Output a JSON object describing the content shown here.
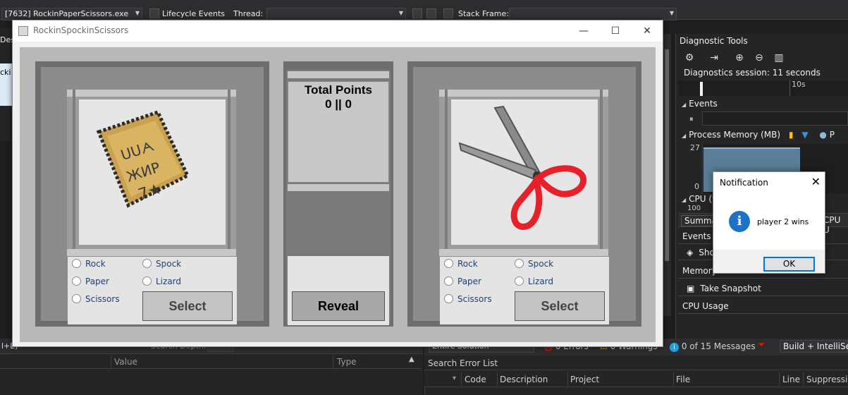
{
  "vs": {
    "process_combo": "[7632] RockinPaperScissors.exe",
    "lifecycle_label": "Lifecycle Events",
    "thread_label": "Thread:",
    "stack_frame_label": "Stack Frame:",
    "left_tab_fragment": "Des",
    "left_item_fragment": "cki",
    "bottom_left": {
      "shortcut_fragment": "l+E)",
      "search_depth_label": "Search Depth:",
      "col_value": "Value",
      "col_type": "Type"
    },
    "error_list": {
      "scope": "Entire Solution",
      "errors": "0 Errors",
      "warnings": "0 Warnings",
      "messages": "0 of 15 Messages",
      "build_filter": "Build + IntelliSense",
      "search_placeholder": "Search Error List",
      "columns": [
        "Code",
        "Description",
        "Project",
        "File",
        "Line",
        "Suppression"
      ]
    },
    "diagnostics": {
      "title": "Diagnostic Tools",
      "session": "Diagnostics session: 11 seconds",
      "timeline_tick": "10s",
      "events_label": "Events",
      "process_memory_label": "Process Memory (MB)",
      "legend_p": "P",
      "mem_max": "27",
      "mem_min": "0",
      "cpu_label": "CPU (%",
      "cpu_fragment": "100",
      "tab_summary": "Summa",
      "tab_cpu": "CPU U",
      "row_events": "Events",
      "row_show": "Sho",
      "row_memory": "Memory",
      "row_snapshot": "Take Snapshot",
      "row_cpu": "CPU Usage"
    }
  },
  "game": {
    "window_title": "RockinSpockinScissors",
    "minimize_glyph": "—",
    "maximize_glyph": "☐",
    "close_glyph": "✕",
    "player1": {
      "choices_left": [
        "Rock",
        "Paper",
        "Scissors"
      ],
      "choices_right": [
        "Spock",
        "Lizard"
      ],
      "select_label": "Select",
      "image_icon": "paper-icon"
    },
    "player2": {
      "choices_left": [
        "Rock",
        "Paper",
        "Scissors"
      ],
      "choices_right": [
        "Spock",
        "Lizard"
      ],
      "select_label": "Select",
      "image_icon": "scissors-icon"
    },
    "score": {
      "title": "Total Points",
      "value": "0 || 0"
    },
    "reveal_label": "Reveal"
  },
  "notification": {
    "title": "Notification",
    "message": "player 2 wins",
    "ok_label": "OK",
    "icon": "info-icon",
    "close_glyph": "✕"
  }
}
